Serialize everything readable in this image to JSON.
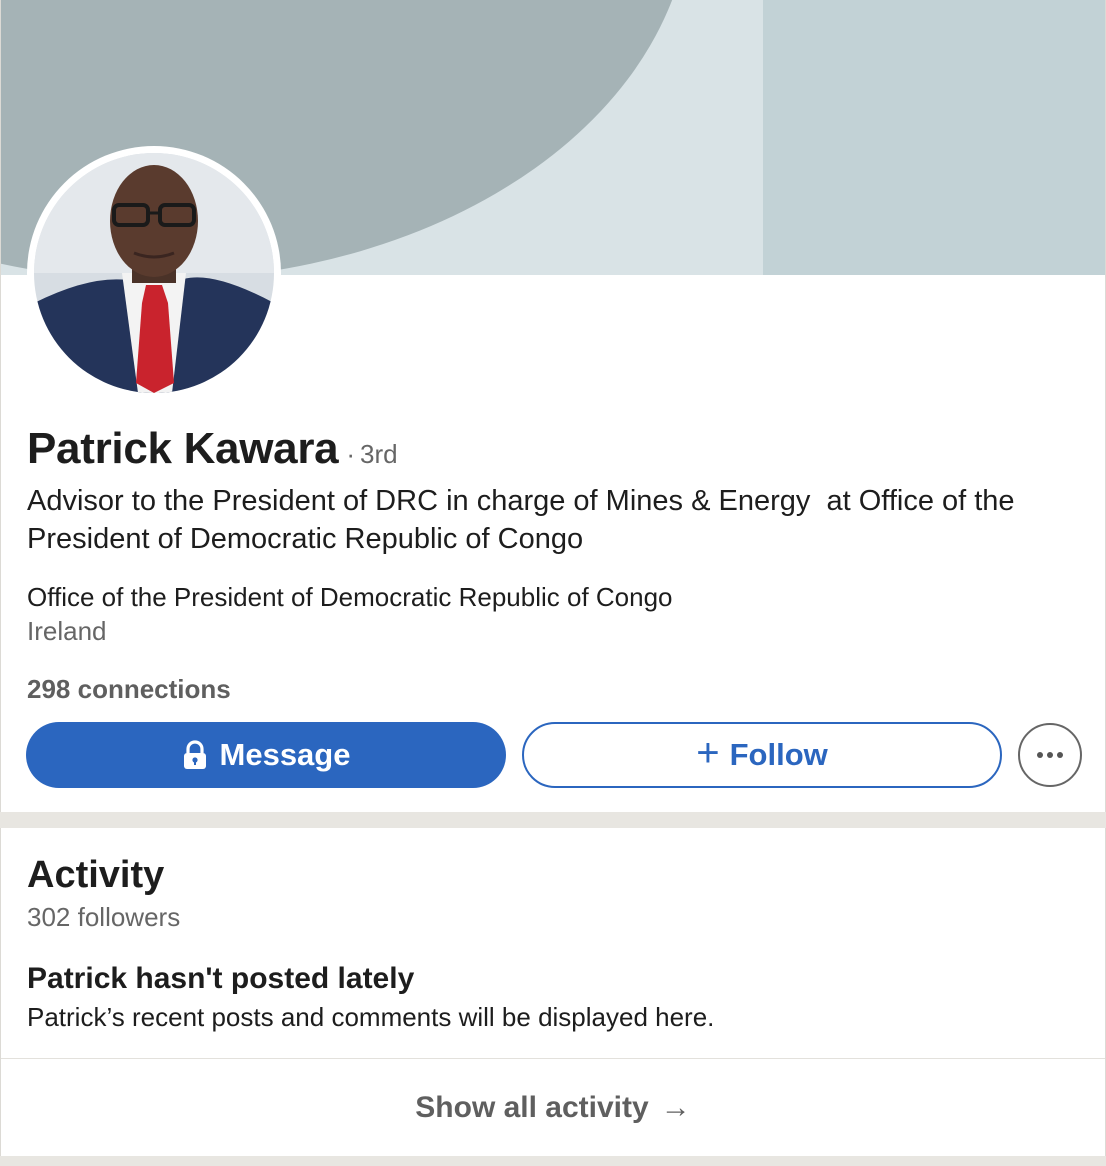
{
  "profile": {
    "name": "Patrick Kawara",
    "degree_separator": "·",
    "degree": "3rd",
    "headline": "Advisor to the President of DRC in charge of Mines & Energy  at Office of the President of Democratic Republic of Congo",
    "company": "Office of the President of Democratic Republic of Congo",
    "location": "Ireland",
    "connections": "298 connections"
  },
  "actions": {
    "message_label": "Message",
    "follow_plus": "+",
    "follow_label": "Follow"
  },
  "activity": {
    "title": "Activity",
    "followers": "302 followers",
    "empty_title": "Patrick hasn't posted lately",
    "empty_subtitle": "Patrick’s recent posts and comments will be displayed here.",
    "show_all_label": "Show all activity",
    "show_all_arrow": "→"
  },
  "colors": {
    "primary": "#2b66bf",
    "banner_light": "#d9e3e6",
    "banner_arc": "#a5b3b6",
    "banner_block": "#c2d2d6",
    "page_bg": "#e8e6e1"
  },
  "icons": {
    "message_lock": "lock-icon",
    "more": "more-horizontal-icon",
    "show_all": "arrow-right-icon"
  }
}
